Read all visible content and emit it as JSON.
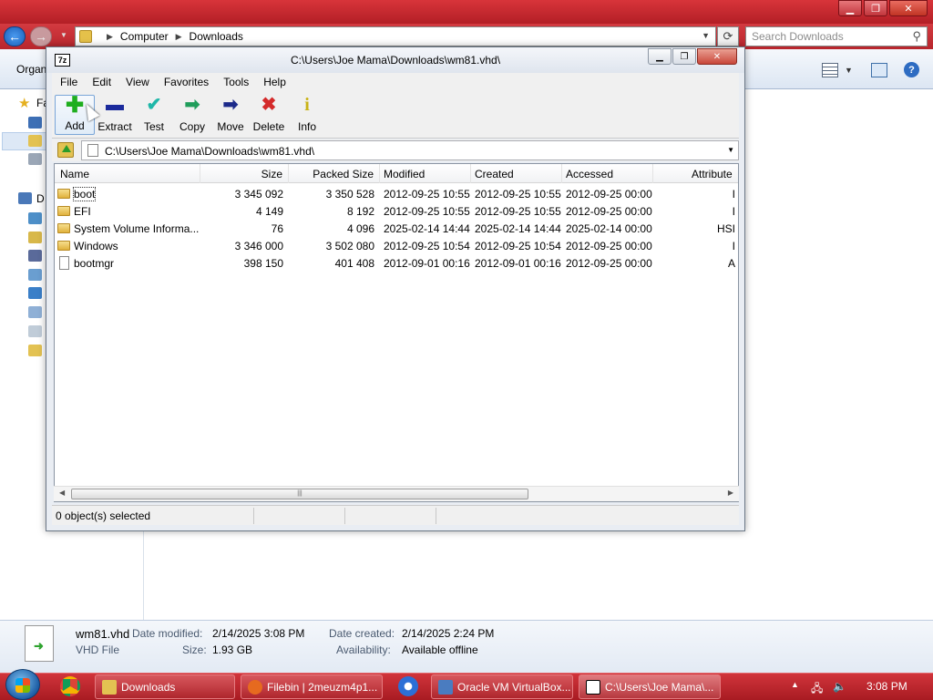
{
  "explorer": {
    "breadcrumb": [
      "Computer",
      "Downloads"
    ],
    "search_placeholder": "Search Downloads",
    "organize": "Organ",
    "nav_favorites": "Fa",
    "nav_d": "D",
    "details": {
      "name": "wm81.vhd",
      "type": "VHD File",
      "date_modified_label": "Date modified:",
      "date_modified": "2/14/2025 3:08 PM",
      "size_label": "Size:",
      "size": "1.93 GB",
      "date_created_label": "Date created:",
      "date_created": "2/14/2025 2:24 PM",
      "availability_label": "Availability:",
      "availability": "Available offline"
    }
  },
  "sevenzip": {
    "title": "C:\\Users\\Joe Mama\\Downloads\\wm81.vhd\\",
    "menu": [
      "File",
      "Edit",
      "View",
      "Favorites",
      "Tools",
      "Help"
    ],
    "toolbar": [
      {
        "label": "Add",
        "icon": "plus-icon",
        "color": "#1fae1f"
      },
      {
        "label": "Extract",
        "icon": "minus-icon",
        "color": "#1b2a9c"
      },
      {
        "label": "Test",
        "icon": "check-icon",
        "color": "#1fb7a8"
      },
      {
        "label": "Copy",
        "icon": "copy-arrow-icon",
        "color": "#1f9d5a"
      },
      {
        "label": "Move",
        "icon": "move-arrow-icon",
        "color": "#1c2a8a"
      },
      {
        "label": "Delete",
        "icon": "delete-x-icon",
        "color": "#d42a2a"
      },
      {
        "label": "Info",
        "icon": "info-icon",
        "color": "#d8c21a"
      }
    ],
    "path": "C:\\Users\\Joe Mama\\Downloads\\wm81.vhd\\",
    "columns": [
      "Name",
      "Size",
      "Packed Size",
      "Modified",
      "Created",
      "Accessed",
      "Attribute"
    ],
    "rows": [
      {
        "name": "boot",
        "size": "3 345 092",
        "packed": "3 350 528",
        "modified": "2012-09-25 10:55",
        "created": "2012-09-25 10:55",
        "accessed": "2012-09-25 00:00",
        "attr": "I",
        "kind": "folder"
      },
      {
        "name": "EFI",
        "size": "4 149",
        "packed": "8 192",
        "modified": "2012-09-25 10:55",
        "created": "2012-09-25 10:55",
        "accessed": "2012-09-25 00:00",
        "attr": "I",
        "kind": "folder"
      },
      {
        "name": "System Volume Informa...",
        "size": "76",
        "packed": "4 096",
        "modified": "2025-02-14 14:44",
        "created": "2025-02-14 14:44",
        "accessed": "2025-02-14 00:00",
        "attr": "HSI",
        "kind": "folder"
      },
      {
        "name": "Windows",
        "size": "3 346 000",
        "packed": "3 502 080",
        "modified": "2012-09-25 10:54",
        "created": "2012-09-25 10:54",
        "accessed": "2012-09-25 00:00",
        "attr": "I",
        "kind": "folder"
      },
      {
        "name": "bootmgr",
        "size": "398 150",
        "packed": "401 408",
        "modified": "2012-09-01 00:16",
        "created": "2012-09-01 00:16",
        "accessed": "2012-09-25 00:00",
        "attr": "A",
        "kind": "file"
      }
    ],
    "status": "0 object(s) selected"
  },
  "taskbar": {
    "buttons": [
      "Downloads",
      "Filebin | 2meuzm4p1...",
      "Oracle VM VirtualBox...",
      "C:\\Users\\Joe Mama\\..."
    ],
    "clock": "3:08 PM"
  }
}
